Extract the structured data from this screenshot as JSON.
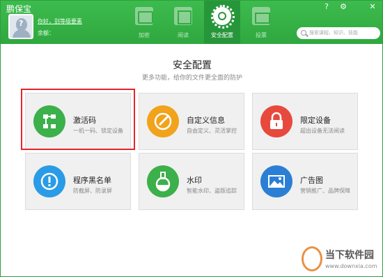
{
  "window": {
    "title": "鹏保宝",
    "help_label": "?",
    "settings_label": "⚙",
    "close_label": "✕"
  },
  "user": {
    "greeting": "你好，别等级要素",
    "balance_label": "余额："
  },
  "nav": {
    "tabs": [
      {
        "label": "加密",
        "icon": "folder-icon",
        "active": false
      },
      {
        "label": "阅读",
        "icon": "video-icon",
        "active": false
      },
      {
        "label": "安全配置",
        "icon": "gear-icon",
        "active": true
      },
      {
        "label": "投票",
        "icon": "vote-icon",
        "active": false
      }
    ]
  },
  "search": {
    "placeholder": "搜索课程、知识、技能"
  },
  "main": {
    "title": "安全配置",
    "subtitle": "更多功能，给你的文件更全面的防护",
    "cards": [
      {
        "name": "激活码",
        "desc": "一机一码、锁定设备",
        "color": "#3cb04a",
        "icon": "flowchart-icon",
        "selected": true
      },
      {
        "name": "自定义信息",
        "desc": "自由定义、灵活掌控",
        "color": "#f1a31c",
        "icon": "pencil-icon",
        "selected": false
      },
      {
        "name": "限定设备",
        "desc": "超出设备无法阅读",
        "color": "#e8493d",
        "icon": "lock-icon",
        "selected": false
      },
      {
        "name": "程序黑名单",
        "desc": "防截屏、防录屏",
        "color": "#2a9be6",
        "icon": "alert-icon",
        "selected": false
      },
      {
        "name": "水印",
        "desc": "智能水印、盗版追踪",
        "color": "#3cb04a",
        "icon": "flask-icon",
        "selected": false
      },
      {
        "name": "广告图",
        "desc": "营销推广、品牌保障",
        "color": "#2a7fd4",
        "icon": "image-icon",
        "selected": false
      }
    ]
  },
  "watermark": {
    "text": "当下软件园",
    "url": "www.downxia.com"
  }
}
